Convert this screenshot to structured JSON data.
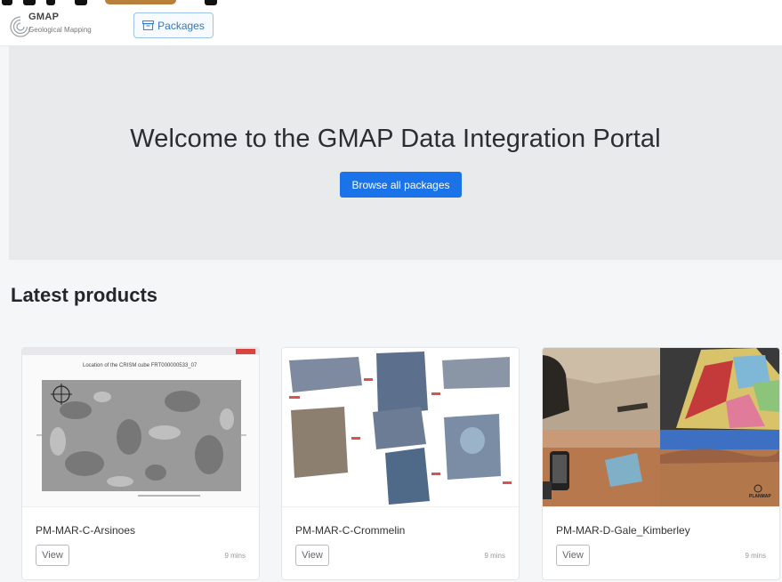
{
  "brand": {
    "name": "GMAP",
    "subtitle": "Geological Mapping"
  },
  "nav": {
    "packages_label": "Packages"
  },
  "hero": {
    "title": "Welcome to the GMAP Data Integration Portal",
    "button_label": "Browse all packages"
  },
  "latest": {
    "heading": "Latest products"
  },
  "cards": [
    {
      "title": "PM-MAR-C-Arsinoes",
      "view_label": "View",
      "time": "9 mins",
      "thumbnail_caption": "Location of the CRISM cube FRT000000533_07"
    },
    {
      "title": "PM-MAR-C-Crommelin",
      "view_label": "View",
      "time": "9 mins"
    },
    {
      "title": "PM-MAR-D-Gale_Kimberley",
      "view_label": "View",
      "time": "9 mins"
    }
  ],
  "colors": {
    "primary": "#1a73e8",
    "nav_accent": "#2d78c4",
    "hero_bg": "#e9eaec",
    "page_bg": "#f5f6f8"
  },
  "icons": {
    "packages": "package-icon",
    "brand": "gmap-logo-icon"
  }
}
